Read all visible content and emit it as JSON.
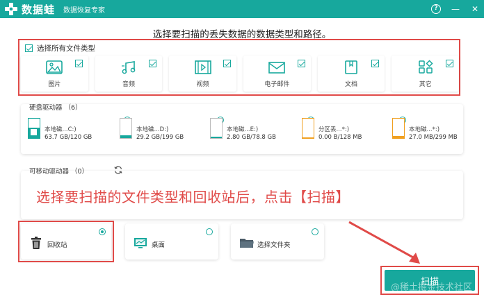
{
  "app": {
    "name": "数据蛙",
    "subtitle": "数据恢复专家",
    "accent_color": "#17a89d",
    "annotation_color": "#e04a48"
  },
  "window_controls": {
    "help": "?",
    "minimize": "—",
    "close": "✕"
  },
  "headline": "选择要扫描的丢失数据的数据类型和路径。",
  "file_types": {
    "select_all_label": "选择所有文件类型",
    "select_all_checked": true,
    "items": [
      {
        "label": "图片",
        "icon": "image-icon",
        "checked": true
      },
      {
        "label": "音频",
        "icon": "music-icon",
        "checked": true
      },
      {
        "label": "视频",
        "icon": "video-icon",
        "checked": true
      },
      {
        "label": "电子邮件",
        "icon": "email-icon",
        "checked": true
      },
      {
        "label": "文档",
        "icon": "document-icon",
        "checked": true
      },
      {
        "label": "其它",
        "icon": "other-icon",
        "checked": true
      }
    ]
  },
  "hard_drives": {
    "title": "硬盘驱动器 （6）",
    "items": [
      {
        "name": "本地磁...C:)",
        "size": "63.7 GB/120 GB",
        "used_fraction": 0.53,
        "system": true
      },
      {
        "name": "本地磁...D:)",
        "size": "29.2 GB/199 GB",
        "used_fraction": 0.15,
        "system": false
      },
      {
        "name": "本地磁...E:)",
        "size": "2.80 GB/78.8 GB",
        "used_fraction": 0.04,
        "system": false
      },
      {
        "name": "分区丢...*:)",
        "size": "0.00  B/128 MB",
        "used_fraction": 0.0,
        "system": false
      },
      {
        "name": "本地磁...*:)",
        "size": "27.0 MB/299 MB",
        "used_fraction": 0.09,
        "system": false
      }
    ]
  },
  "removable": {
    "title": "可移动驱动器 （0）",
    "refresh_icon": "refresh-icon"
  },
  "instruction": "选择要扫描的文件类型和回收站后，点击【扫描】",
  "locations": [
    {
      "label": "回收站",
      "icon": "trash-icon",
      "selected": true
    },
    {
      "label": "桌面",
      "icon": "desktop-icon",
      "selected": false
    },
    {
      "label": "选择文件夹",
      "icon": "folder-icon",
      "selected": false
    }
  ],
  "scan_button": "扫描",
  "watermark": "@稀土掘金技术社区"
}
